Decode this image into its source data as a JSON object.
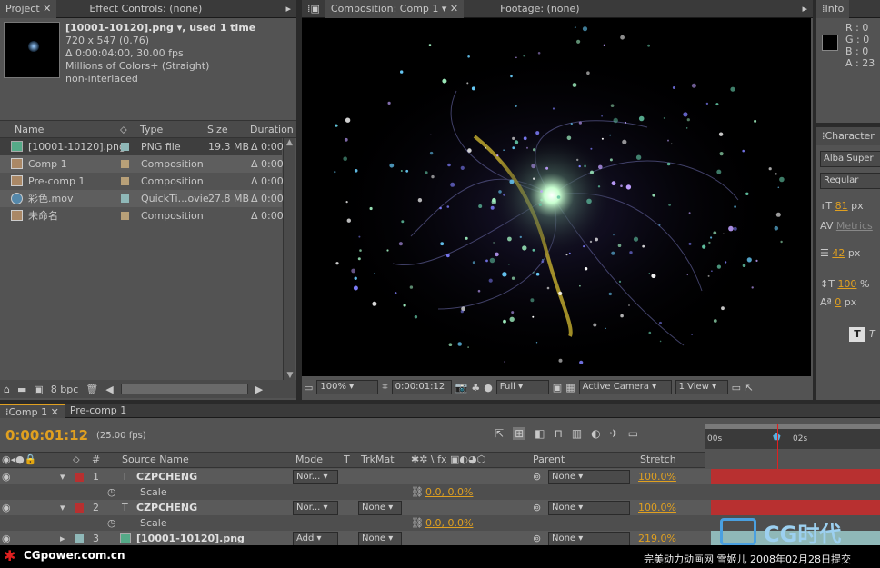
{
  "project": {
    "tab": "Project",
    "effects_tab": "Effect Controls: (none)",
    "file_title": "[10001-10120].png ▾, used 1 time",
    "dims": "720 x 547 (0.76)",
    "duration": "Δ 0:00:04:00, 30.00 fps",
    "colors": "Millions of Colors+ (Straight)",
    "interlace": "non-interlaced",
    "columns": [
      "Name",
      "Type",
      "Size",
      "Duration"
    ],
    "items": [
      {
        "name": "[10001-10120].png",
        "type": "PNG file",
        "size": "19.3 MB",
        "duration": "Δ 0:00",
        "label": "#8fb8b8"
      },
      {
        "name": "Comp 1",
        "type": "Composition",
        "size": "",
        "duration": "Δ 0:00",
        "label": "#b8a078"
      },
      {
        "name": "Pre-comp 1",
        "type": "Composition",
        "size": "",
        "duration": "Δ 0:00",
        "label": "#b8a078"
      },
      {
        "name": "彩色.mov",
        "type": "QuickTi…ovie",
        "size": "27.8 MB",
        "duration": "Δ 0:00",
        "label": "#8fb8b8"
      },
      {
        "name": "未命名",
        "type": "Composition",
        "size": "",
        "duration": "Δ 0:00",
        "label": "#b8a078"
      }
    ],
    "bpc": "8 bpc"
  },
  "viewer": {
    "comp_tab": "Composition: Comp 1",
    "footage_tab": "Footage: (none)",
    "zoom": "100%",
    "timecode": "0:00:01:12",
    "resolution": "Full",
    "camera": "Active Camera",
    "views": "1 View"
  },
  "info": {
    "tab": "Info",
    "r": "R : 0",
    "g": "G : 0",
    "b": "B : 0",
    "a": "A : 23"
  },
  "character": {
    "tab": "Character",
    "font": "Alba Super",
    "style": "Regular",
    "size": "81",
    "size_unit": "px",
    "kerning": "Metrics",
    "leading": "42",
    "leading_unit": "px",
    "vscale": "100",
    "vscale_unit": "%",
    "baseline": "0",
    "baseline_unit": "px"
  },
  "timeline": {
    "tabs": [
      "Comp 1",
      "Pre-comp 1"
    ],
    "timecode": "0:00:01:12",
    "fps": "(25.00 fps)",
    "ruler": [
      "00s",
      "02s"
    ],
    "headers": {
      "num": "#",
      "source": "Source Name",
      "mode": "Mode",
      "t": "T",
      "trkmat": "TrkMat",
      "parent": "Parent",
      "stretch": "Stretch"
    },
    "layers": [
      {
        "num": "1",
        "name": "CZPCHENG",
        "mode": "Nor...",
        "trkmat": "",
        "parent": "None",
        "stretch": "100.0%",
        "label": "#b83030"
      },
      {
        "prop": "Scale",
        "value": "0.0, 0.0%"
      },
      {
        "num": "2",
        "name": "CZPCHENG",
        "mode": "Nor...",
        "trkmat": "None",
        "parent": "None",
        "stretch": "100.0%",
        "label": "#b83030"
      },
      {
        "prop": "Scale",
        "value": "0.0, 0.0%"
      },
      {
        "num": "3",
        "name": "[10001-10120].png",
        "mode": "Add",
        "trkmat": "None",
        "parent": "None",
        "stretch": "219.0%",
        "label": "#8fb8b8"
      }
    ]
  },
  "watermark": {
    "left": "CGpower.com.cn",
    "right": "完美动力动画网 雪姬儿 2008年02月28日提交",
    "logo": "CG时代"
  },
  "colors": {
    "accent": "#e0a020",
    "panel": "#535353"
  }
}
